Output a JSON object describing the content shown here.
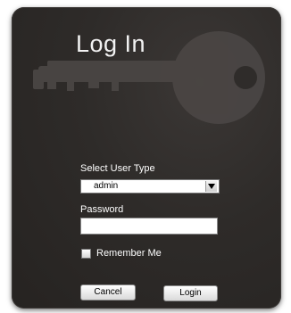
{
  "login": {
    "title": "Log In",
    "user_type_label": "Select User Type",
    "user_type_selected": "admin",
    "password_label": "Password",
    "password_value": "",
    "remember_label": "Remember Me",
    "remember_checked": false,
    "cancel_label": "Cancel",
    "login_label": "Login"
  },
  "icons": {
    "decoration": "key-icon",
    "dropdown": "chevron-down-icon"
  },
  "colors": {
    "panel_background": "#2e2b29",
    "text": "#ffffff"
  }
}
